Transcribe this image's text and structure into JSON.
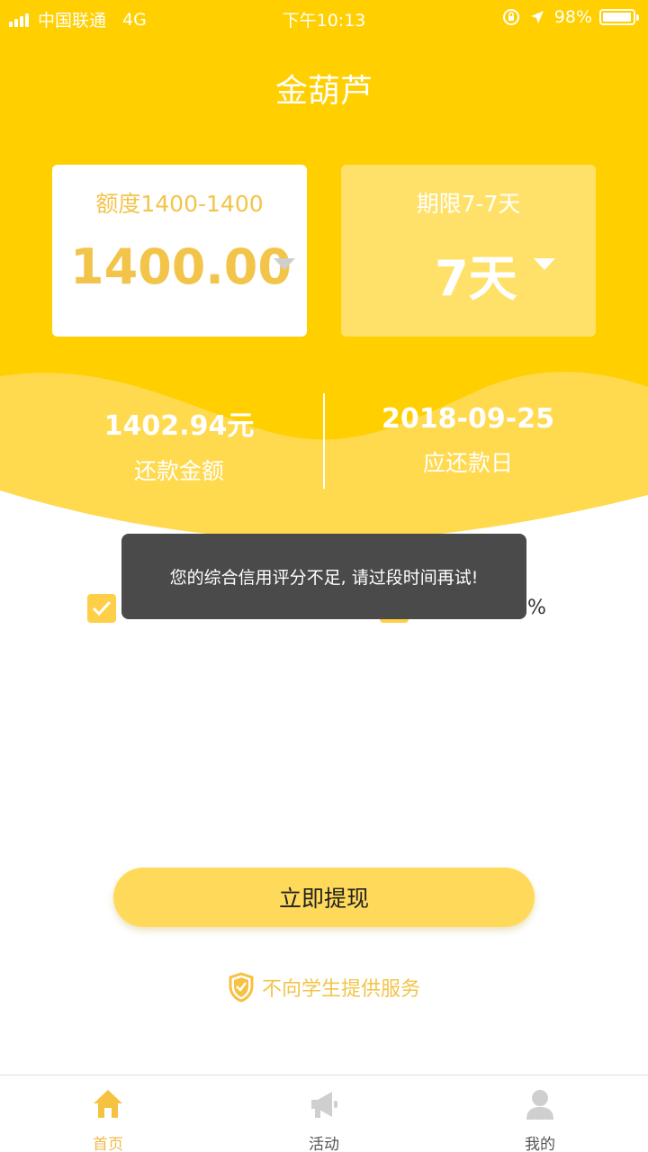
{
  "status_bar": {
    "carrier": "中国联通",
    "network": "4G",
    "time": "下午10:13",
    "battery": "98%"
  },
  "app_title": "金葫芦",
  "amount_card": {
    "caption": "额度1400-1400",
    "value": "1400.00"
  },
  "term_card": {
    "caption": "期限7-7天",
    "value": "7天"
  },
  "summary": {
    "repay_amount": "1402.94元",
    "repay_amount_label": "还款金额",
    "due_date": "2018-09-25",
    "due_date_label": "应还款日"
  },
  "options": {
    "right_partial": "0%"
  },
  "toast": {
    "message": "您的综合信用评分不足, 请过段时间再试!"
  },
  "cta_label": "立即提现",
  "notice": "不向学生提供服务",
  "tabbar": {
    "items": [
      {
        "label": "首页",
        "icon": "home-icon",
        "active": true
      },
      {
        "label": "活动",
        "icon": "megaphone-icon",
        "active": false
      },
      {
        "label": "我的",
        "icon": "person-icon",
        "active": false
      }
    ]
  },
  "colors": {
    "primary_yellow": "#ffd200",
    "accent_text": "#f2c44a",
    "toast_bg": "#4a4a4a"
  }
}
